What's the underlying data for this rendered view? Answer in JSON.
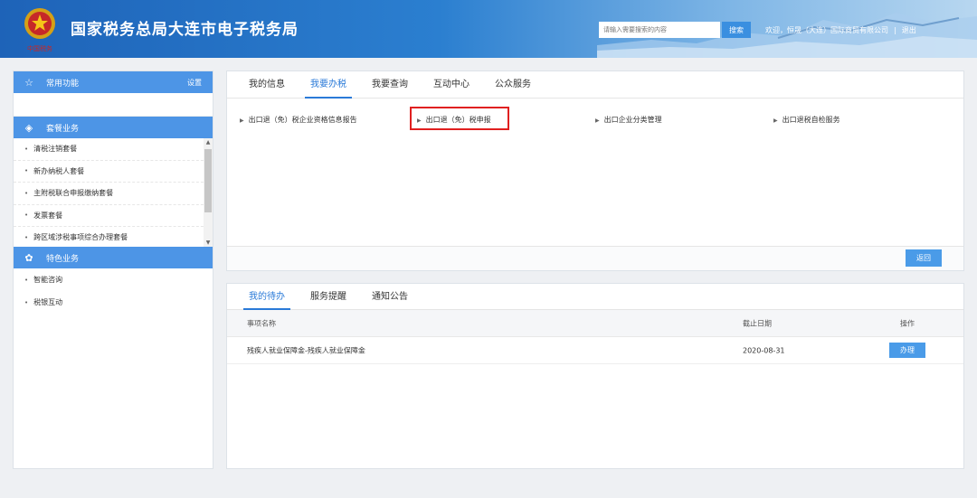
{
  "header": {
    "title": "国家税务总局大连市电子税务局",
    "search_placeholder": "请输入需要搜索的内容",
    "search_button": "搜索",
    "welcome": "欢迎，恒晟（大连）国际商贸有限公司",
    "separator": "|",
    "logout": "退出",
    "emblem_text": "中国税务"
  },
  "sidebar": {
    "common": {
      "label": "常用功能",
      "setting": "设置"
    },
    "package": {
      "label": "套餐业务",
      "items": [
        "清税注销套餐",
        "新办纳税人套餐",
        "主附税联合申报缴纳套餐",
        "发票套餐",
        "跨区域涉税事项综合办理套餐"
      ]
    },
    "special": {
      "label": "特色业务",
      "items": [
        "智能咨询",
        "税银互动"
      ]
    }
  },
  "main_tabs": [
    {
      "label": "我的信息",
      "active": false
    },
    {
      "label": "我要办税",
      "active": true
    },
    {
      "label": "我要查询",
      "active": false
    },
    {
      "label": "互动中心",
      "active": false
    },
    {
      "label": "公众服务",
      "active": false
    }
  ],
  "links": [
    "出口退（免）税企业资格信息报告",
    "出口退（免）税申报",
    "出口企业分类管理",
    "出口退税自检服务"
  ],
  "back_button": "返回",
  "todo_tabs": [
    {
      "label": "我的待办",
      "active": true
    },
    {
      "label": "服务提醒",
      "active": false
    },
    {
      "label": "通知公告",
      "active": false
    }
  ],
  "todo_table": {
    "headers": {
      "name": "事项名称",
      "date": "截止日期",
      "op": "操作"
    },
    "rows": [
      {
        "name": "残疾人就业保障金-残疾人就业保障金",
        "date": "2020-08-31",
        "action": "办理"
      }
    ]
  },
  "colors": {
    "header_blue": "#1e63b8",
    "accent": "#2a7ad8",
    "sidebar_head": "#4d95e6",
    "highlight": "#e02020"
  }
}
